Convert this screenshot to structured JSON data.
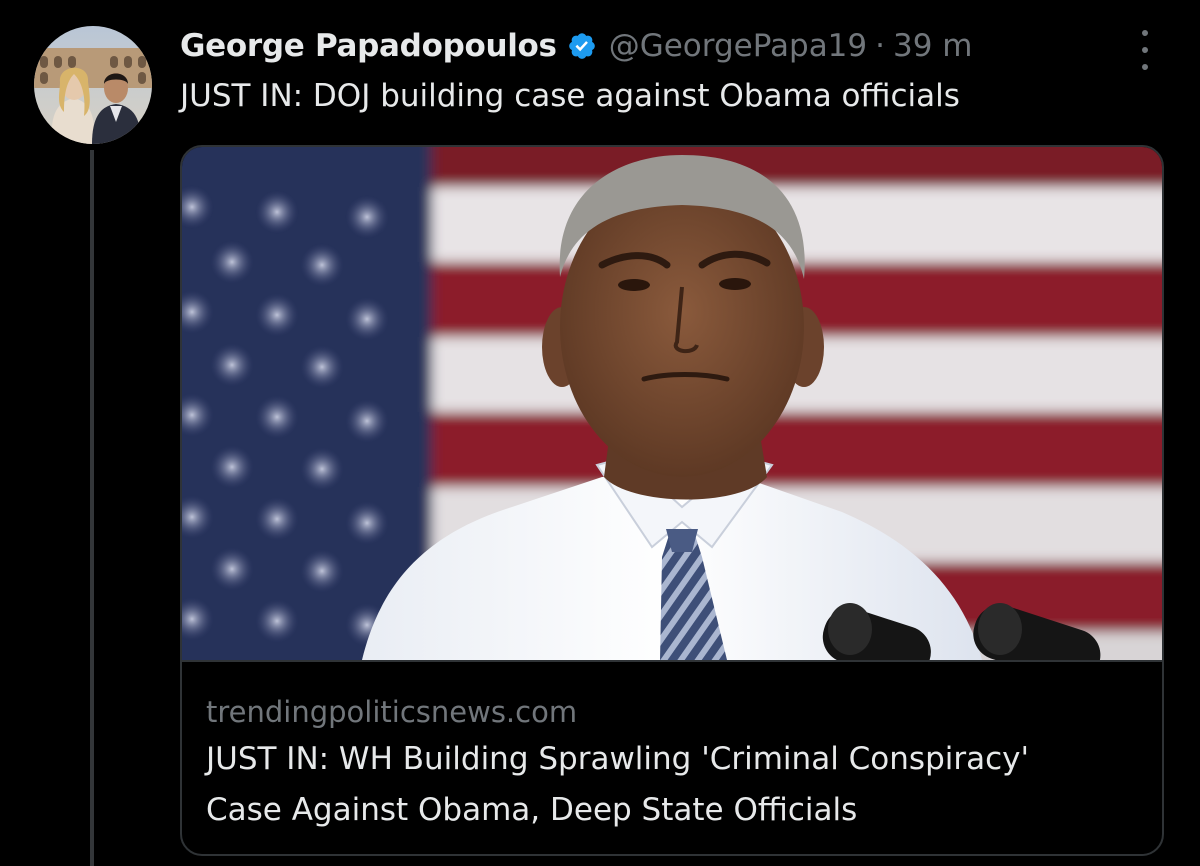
{
  "author": {
    "display_name": "George Papadopoulos",
    "handle": "@GeorgePapa19",
    "separator": "·",
    "time": "39 m",
    "verified": true
  },
  "tweet": {
    "text": "JUST IN: DOJ building case against Obama officials"
  },
  "card": {
    "domain": "trendingpoliticsnews.com",
    "title_line1": "JUST IN: WH Building Sprawling 'Criminal Conspiracy'",
    "title_line2": "Case Against Obama, Deep State Officials"
  },
  "icons": {
    "verified": "verified-badge-icon",
    "more": "more-options-icon"
  },
  "colors": {
    "background": "#000000",
    "primary_text": "#e7e9ea",
    "secondary_text": "#71767b",
    "verified_blue": "#1d9bf0",
    "border": "#2f3336"
  }
}
